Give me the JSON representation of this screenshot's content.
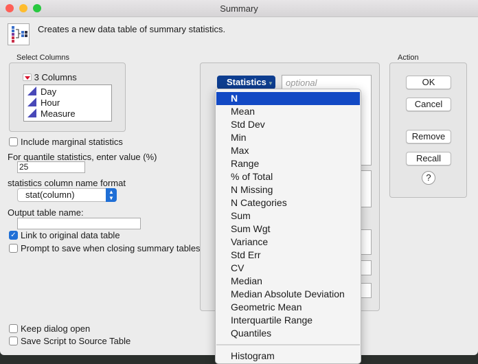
{
  "window": {
    "title": "Summary"
  },
  "header": {
    "description": "Creates a new data table of summary statistics."
  },
  "select_columns": {
    "label": "Select Columns",
    "count_label": "3 Columns",
    "columns": [
      "Day",
      "Hour",
      "Measure"
    ]
  },
  "options": {
    "include_marginal": {
      "label": "Include marginal statistics",
      "checked": false
    },
    "quantile_label": "For quantile statistics, enter value (%)",
    "quantile_value": "25",
    "name_format_label": "statistics column name format",
    "name_format_value": "stat(column)",
    "output_name_label": "Output table name:",
    "output_name_value": "",
    "link_original": {
      "label": "Link to original data table",
      "checked": true
    },
    "prompt_save": {
      "label": "Prompt to save when closing summary tables",
      "checked": false
    },
    "keep_open": {
      "label": "Keep dialog open",
      "checked": false
    },
    "save_script": {
      "label": "Save Script to Source Table",
      "checked": false
    }
  },
  "roles": {
    "statistics_button": "Statistics",
    "optional_placeholder": "optional"
  },
  "action": {
    "label": "Action",
    "ok": "OK",
    "cancel": "Cancel",
    "remove": "Remove",
    "recall": "Recall",
    "help": "?"
  },
  "statistics_menu": {
    "selected": "N",
    "items": [
      "N",
      "Mean",
      "Std Dev",
      "Min",
      "Max",
      "Range",
      "% of Total",
      "N Missing",
      "N Categories",
      "Sum",
      "Sum Wgt",
      "Variance",
      "Std Err",
      "CV",
      "Median",
      "Median Absolute Deviation",
      "Geometric Mean",
      "Interquartile Range",
      "Quantiles"
    ],
    "extra": "Histogram"
  }
}
